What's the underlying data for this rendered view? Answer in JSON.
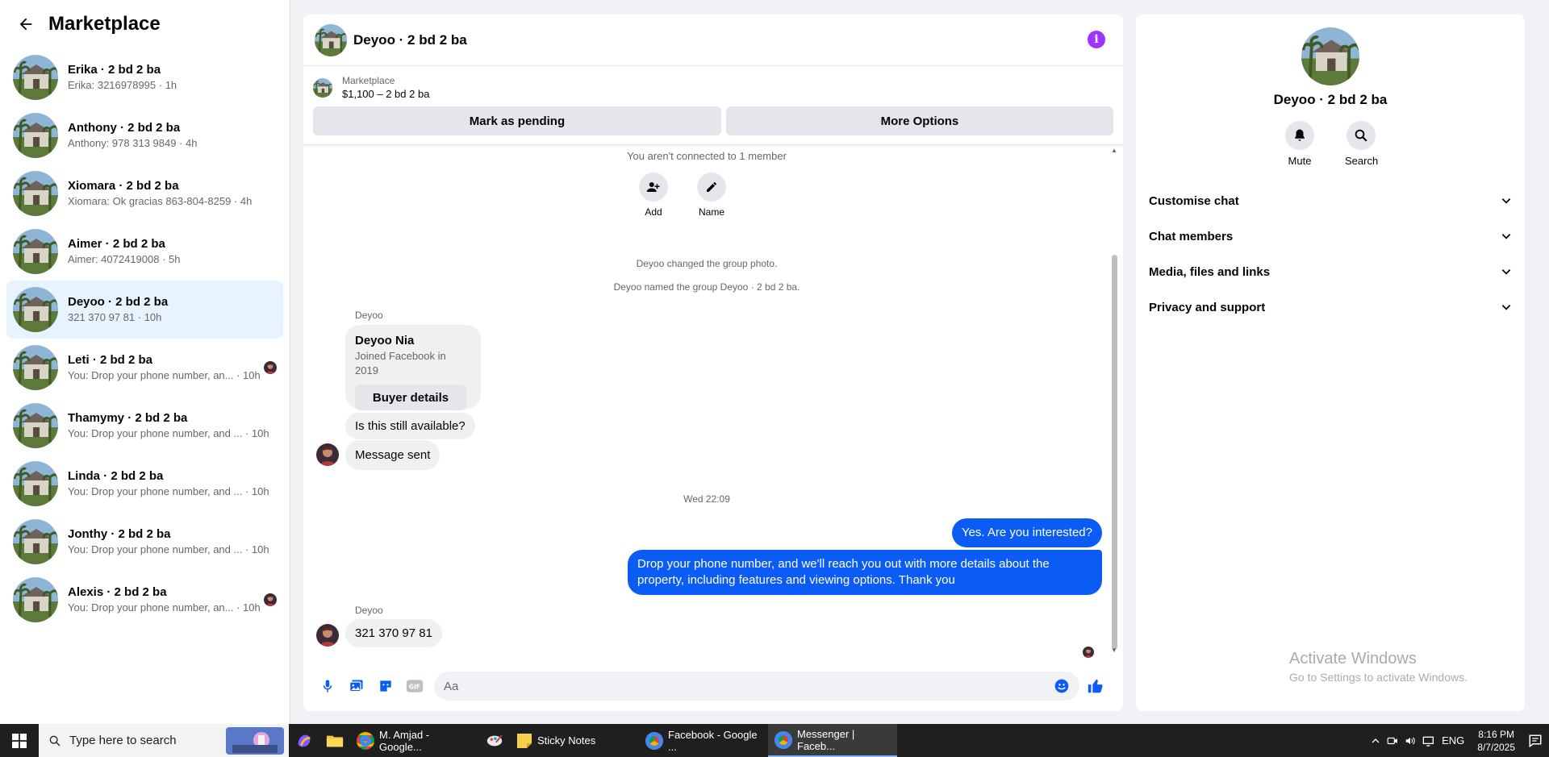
{
  "sidebar": {
    "title": "Marketplace",
    "conversations": [
      {
        "name": "Erika · 2 bd 2 ba",
        "snippet": "Erika: 3216978995 · 1h"
      },
      {
        "name": "Anthony · 2 bd 2 ba",
        "snippet": "Anthony: 978 313 9849 · 4h"
      },
      {
        "name": "Xiomara · 2 bd 2 ba",
        "snippet": "Xiomara: Ok gracias 863-804-8259 · 4h"
      },
      {
        "name": "Aimer · 2 bd 2 ba",
        "snippet": "Aimer: 4072419008 · 5h"
      },
      {
        "name": "Deyoo · 2 bd 2 ba",
        "snippet": "321 370 97 81 · 10h"
      },
      {
        "name": "Leti · 2 bd 2 ba",
        "snippet": "You: Drop your phone number, an... · 10h"
      },
      {
        "name": "Thamymy · 2 bd 2 ba",
        "snippet": "You: Drop your phone number, and ... · 10h"
      },
      {
        "name": "Linda · 2 bd 2 ba",
        "snippet": "You: Drop your phone number, and ... · 10h"
      },
      {
        "name": "Jonthy · 2 bd 2 ba",
        "snippet": "You: Drop your phone number, and ... · 10h"
      },
      {
        "name": "Alexis · 2 bd 2 ba",
        "snippet": "You: Drop your phone number, an... · 10h"
      }
    ]
  },
  "chat": {
    "title": "Deyoo · 2 bd 2 ba",
    "marketplace_label": "Marketplace",
    "listing_price": "$1,100 – 2 bd 2 ba",
    "mark_pending": "Mark as pending",
    "more_options": "More Options",
    "not_connected": "You aren't connected to 1 member",
    "add_label": "Add",
    "name_label": "Name",
    "sys1": "Deyoo changed the group photo.",
    "sys2": "Deyoo named the group Deyoo · 2 bd 2 ba.",
    "sender": "Deyoo",
    "card_name": "Deyoo Nia",
    "card_sub": "Joined Facebook in 2019",
    "card_button": "Buyer details",
    "msg_available": "Is this still available?",
    "msg_sent": "Message sent",
    "timestamp": "Wed 22:09",
    "out1": "Yes. Are you interested?",
    "out2": "Drop your phone number, and we'll reach you out with more details about the property, including features and viewing options.  Thank you",
    "in_phone": "321 370 97 81",
    "composer_placeholder": "Aa"
  },
  "info": {
    "name": "Deyoo · 2 bd 2 ba",
    "mute": "Mute",
    "search": "Search",
    "sections": [
      "Customise chat",
      "Chat members",
      "Media, files and links",
      "Privacy and support"
    ],
    "watermark_title": "Activate Windows",
    "watermark_sub": "Go to Settings to activate Windows."
  },
  "taskbar": {
    "search_placeholder": "Type here to search",
    "apps": [
      "M. Amjad - Google...",
      "Sticky Notes",
      "Facebook - Google ...",
      "Messenger | Faceb..."
    ],
    "language": "ENG",
    "time": "8:16 PM",
    "date": "8/7/2025"
  },
  "colors": {
    "accent": "#0a5cf5",
    "active_row": "#e7f3ff",
    "info_icon": "#a033ff"
  }
}
